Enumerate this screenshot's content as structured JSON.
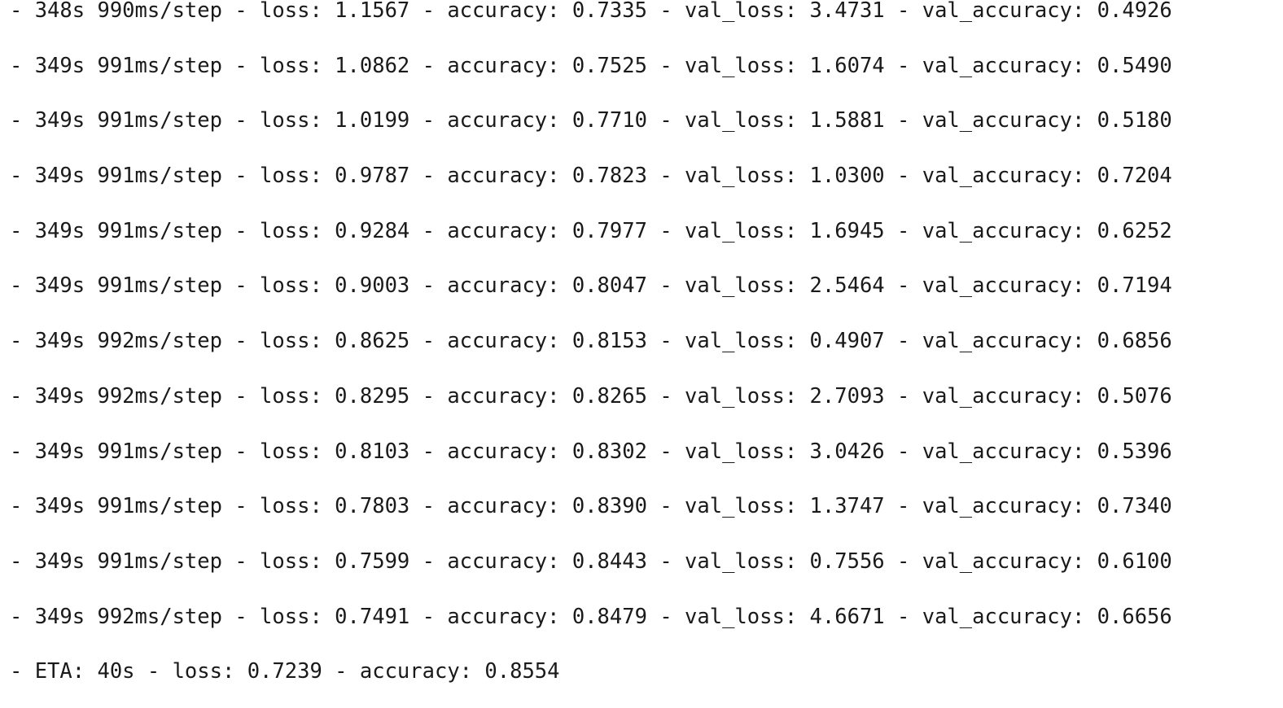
{
  "log_lines": [
    "- 348s 990ms/step - loss: 1.1567 - accuracy: 0.7335 - val_loss: 3.4731 - val_accuracy: 0.4926",
    "- 349s 991ms/step - loss: 1.0862 - accuracy: 0.7525 - val_loss: 1.6074 - val_accuracy: 0.5490",
    "- 349s 991ms/step - loss: 1.0199 - accuracy: 0.7710 - val_loss: 1.5881 - val_accuracy: 0.5180",
    "- 349s 991ms/step - loss: 0.9787 - accuracy: 0.7823 - val_loss: 1.0300 - val_accuracy: 0.7204",
    "- 349s 991ms/step - loss: 0.9284 - accuracy: 0.7977 - val_loss: 1.6945 - val_accuracy: 0.6252",
    "- 349s 991ms/step - loss: 0.9003 - accuracy: 0.8047 - val_loss: 2.5464 - val_accuracy: 0.7194",
    "- 349s 992ms/step - loss: 0.8625 - accuracy: 0.8153 - val_loss: 0.4907 - val_accuracy: 0.6856",
    "- 349s 992ms/step - loss: 0.8295 - accuracy: 0.8265 - val_loss: 2.7093 - val_accuracy: 0.5076",
    "- 349s 991ms/step - loss: 0.8103 - accuracy: 0.8302 - val_loss: 3.0426 - val_accuracy: 0.5396",
    "- 349s 991ms/step - loss: 0.7803 - accuracy: 0.8390 - val_loss: 1.3747 - val_accuracy: 0.7340",
    "- 349s 991ms/step - loss: 0.7599 - accuracy: 0.8443 - val_loss: 0.7556 - val_accuracy: 0.6100",
    "- 349s 992ms/step - loss: 0.7491 - accuracy: 0.8479 - val_loss: 4.6671 - val_accuracy: 0.6656",
    "- ETA: 40s - loss: 0.7239 - accuracy: 0.8554"
  ]
}
